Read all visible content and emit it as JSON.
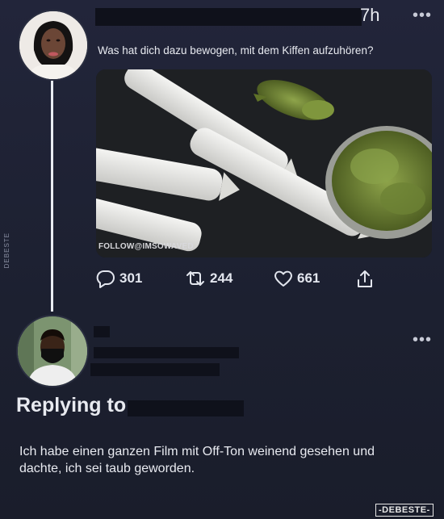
{
  "side_watermark": "DEBESTE",
  "tweet": {
    "time": "7h",
    "more_label": "•••",
    "text": "Was hat dich dazu bewogen, mit dem Kiffen aufzuhören?",
    "photo_credit": "FOLLOW@IMSOWAVED",
    "actions": {
      "replies": "301",
      "retweets": "244",
      "likes": "661"
    }
  },
  "reply": {
    "more_label": "•••",
    "replying_to": "Replying to",
    "text": "Ich habe einen ganzen Film mit Off-Ton weinend gesehen und dachte, ich sei taub geworden."
  },
  "footer_watermark": "-DEBESTE-",
  "colors": {
    "background": "#1e2232",
    "text": "#e8eaf0",
    "thread_line": "#e9ecf2"
  }
}
